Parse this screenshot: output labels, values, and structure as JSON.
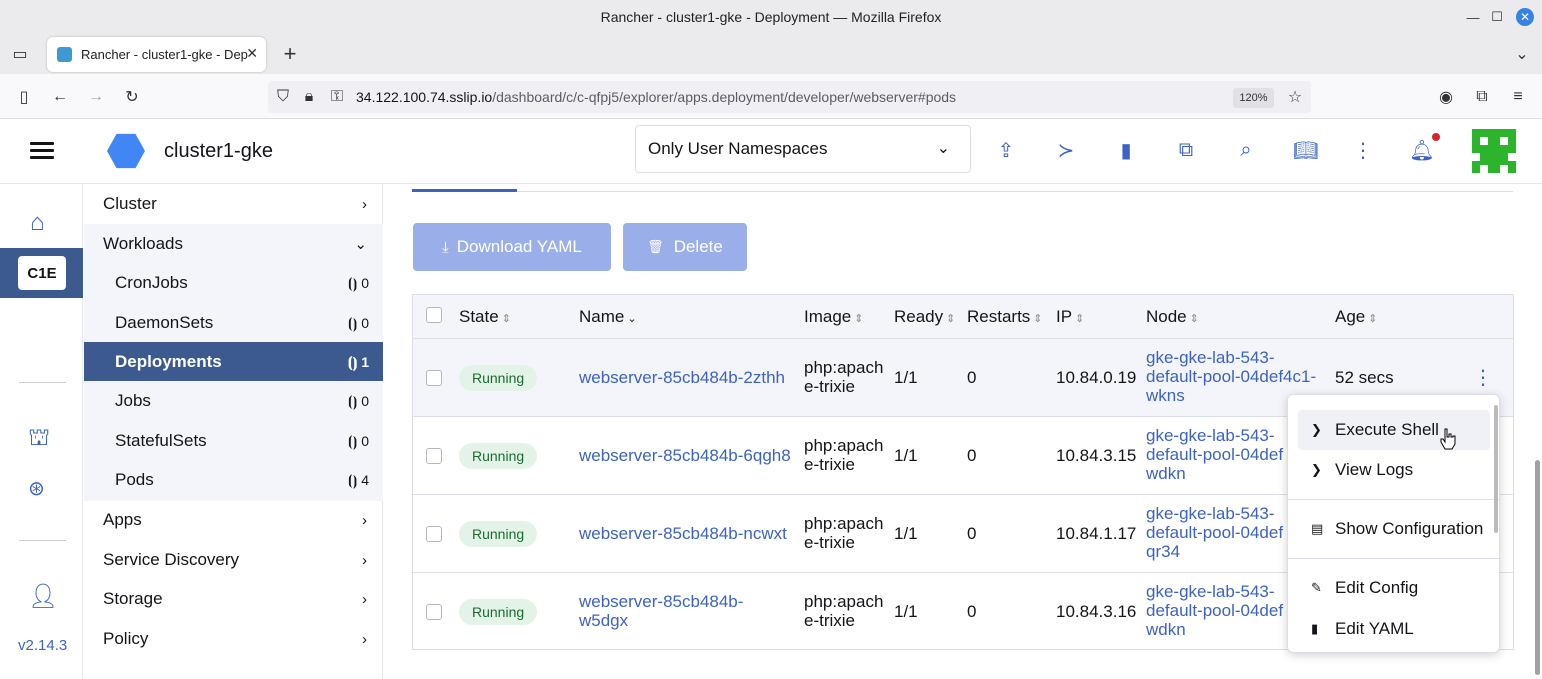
{
  "window": {
    "title": "Rancher - cluster1-gke - Deployment — Mozilla Firefox"
  },
  "browser": {
    "tab_title": "Rancher - cluster1-gke - Dep",
    "url_host": "34.122.100.74.sslip.io",
    "url_path": "/dashboard/c/c-qfpj5/explorer/apps.deployment/developer/webserver#pods",
    "zoom": "120%"
  },
  "header": {
    "cluster_name": "cluster1-gke",
    "namespace_filter": "Only User Namespaces"
  },
  "rail": {
    "cluster_badge": "C1E",
    "version": "v2.14.3"
  },
  "sidenav": {
    "cluster": "Cluster",
    "workloads": "Workloads",
    "items": [
      {
        "label": "CronJobs",
        "count": "0"
      },
      {
        "label": "DaemonSets",
        "count": "0"
      },
      {
        "label": "Deployments",
        "count": "1"
      },
      {
        "label": "Jobs",
        "count": "0"
      },
      {
        "label": "StatefulSets",
        "count": "0"
      },
      {
        "label": "Pods",
        "count": "4"
      }
    ],
    "apps": "Apps",
    "service_discovery": "Service Discovery",
    "storage": "Storage",
    "policy": "Policy"
  },
  "actions": {
    "download_yaml": "Download YAML",
    "delete": "Delete"
  },
  "table": {
    "columns": {
      "state": "State",
      "name": "Name",
      "image": "Image",
      "ready": "Ready",
      "restarts": "Restarts",
      "ip": "IP",
      "node": "Node",
      "age": "Age"
    },
    "rows": [
      {
        "state": "Running",
        "name": "webserver-85cb484b-2zthh",
        "image1": "php:apach",
        "image2": "e-trixie",
        "ready": "1/1",
        "restarts": "0",
        "ip": "10.84.0.19",
        "node1": "gke-gke-lab-543-",
        "node2": "default-pool-04def4c1-",
        "node3": "wkns",
        "age": "52 secs"
      },
      {
        "state": "Running",
        "name": "webserver-85cb484b-6qgh8",
        "image1": "php:apach",
        "image2": "e-trixie",
        "ready": "1/1",
        "restarts": "0",
        "ip": "10.84.3.15",
        "node1": "gke-gke-lab-543-",
        "node2": "default-pool-04def",
        "node3": "wdkn",
        "age": ""
      },
      {
        "state": "Running",
        "name": "webserver-85cb484b-ncwxt",
        "image1": "php:apach",
        "image2": "e-trixie",
        "ready": "1/1",
        "restarts": "0",
        "ip": "10.84.1.17",
        "node1": "gke-gke-lab-543-",
        "node2": "default-pool-04def",
        "node3": "qr34",
        "age": ""
      },
      {
        "state": "Running",
        "name1": "webserver-85cb484b-",
        "name2": "w5dgx",
        "image1": "php:apach",
        "image2": "e-trixie",
        "ready": "1/1",
        "restarts": "0",
        "ip": "10.84.3.16",
        "node1": "gke-gke-lab-543-",
        "node2": "default-pool-04def",
        "node3": "wdkn",
        "age": ""
      }
    ]
  },
  "context_menu": {
    "execute_shell": "Execute Shell",
    "view_logs": "View Logs",
    "show_configuration": "Show Configuration",
    "edit_config": "Edit Config",
    "edit_yaml": "Edit YAML"
  },
  "colors": {
    "primary": "#3d62c1",
    "active_nav": "#3d5a8f",
    "button_disabled": "#9aaee9",
    "running_bg": "#e4f3e7",
    "running_fg": "#1b6b31"
  }
}
